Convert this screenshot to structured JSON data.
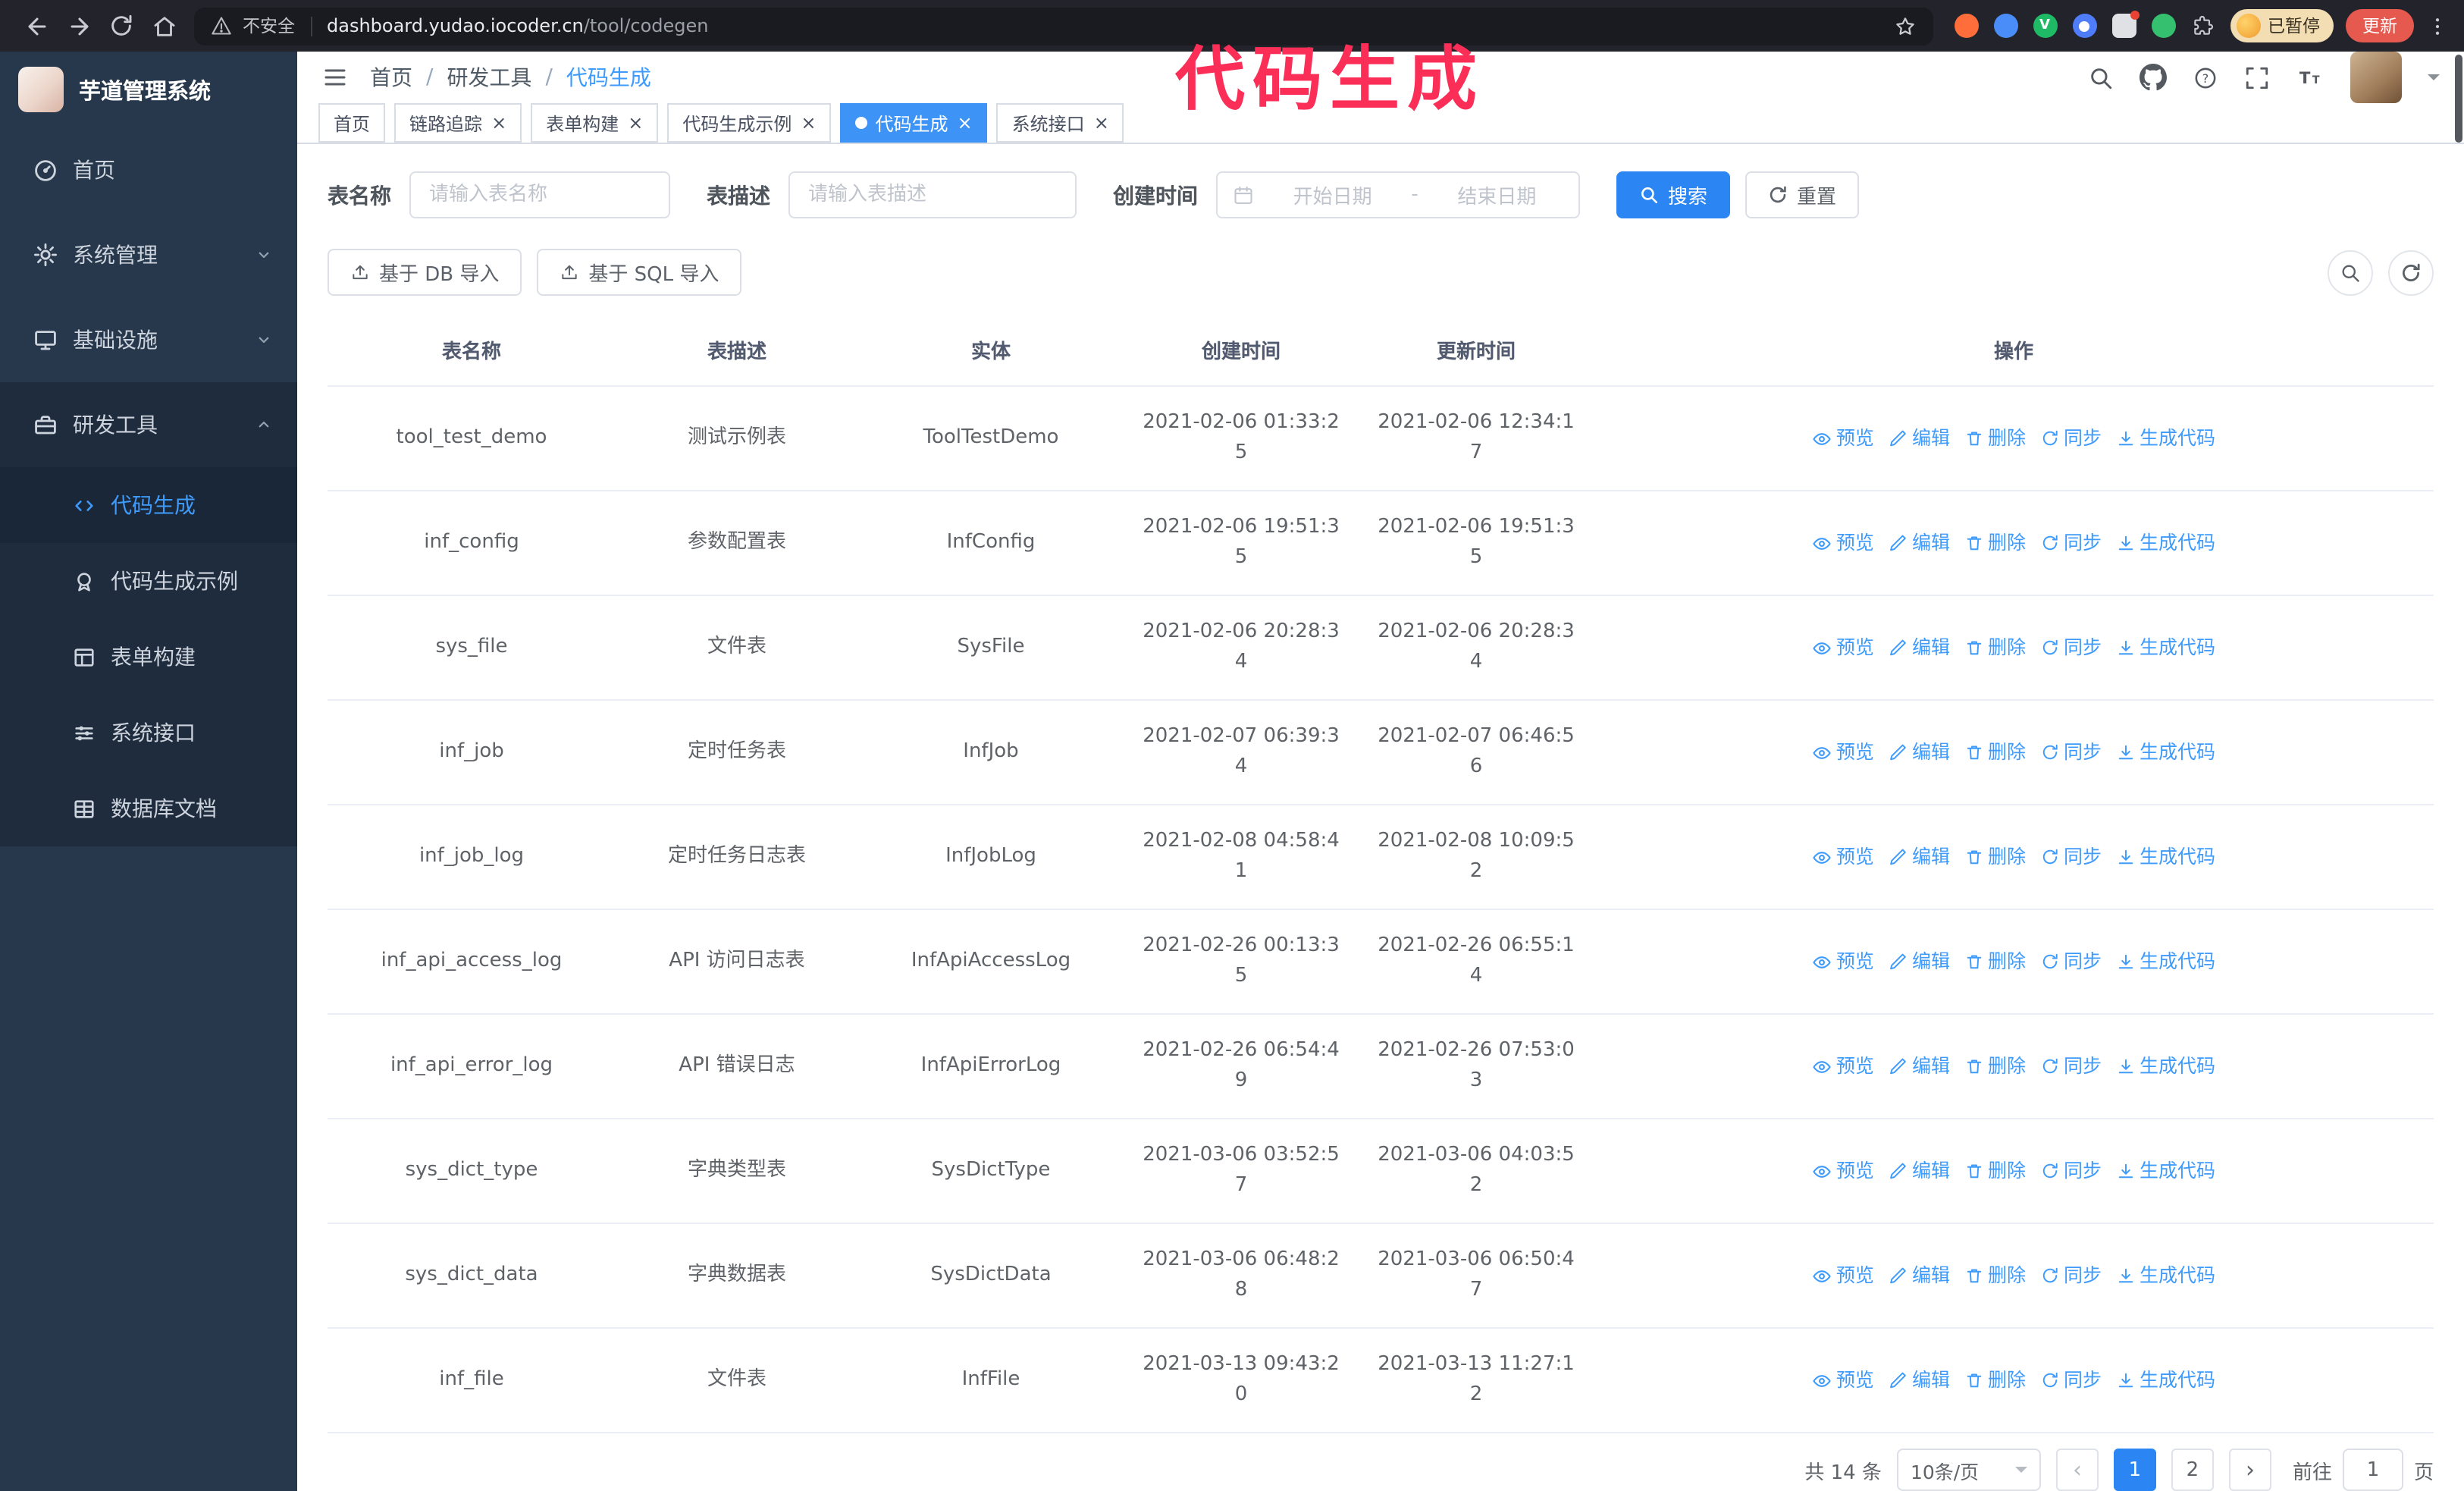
{
  "browser": {
    "security_warning": "不安全",
    "url_domain": "dashboard.yudao.iocoder.cn",
    "url_path": "/tool/codegen",
    "paused_badge": "已暂停",
    "update_button": "更新"
  },
  "annotation": {
    "text": "代码生成",
    "color": "#fb2e57"
  },
  "sidebar": {
    "app_title": "芋道管理系统",
    "items": [
      {
        "label": "首页"
      },
      {
        "label": "系统管理"
      },
      {
        "label": "基础设施"
      },
      {
        "label": "研发工具"
      }
    ],
    "submenu": [
      {
        "label": "代码生成"
      },
      {
        "label": "代码生成示例"
      },
      {
        "label": "表单构建"
      },
      {
        "label": "系统接口"
      },
      {
        "label": "数据库文档"
      }
    ]
  },
  "breadcrumb": {
    "items": [
      "首页",
      "研发工具",
      "代码生成"
    ],
    "separator": "/"
  },
  "tabs": [
    {
      "label": "首页"
    },
    {
      "label": "链路追踪"
    },
    {
      "label": "表单构建"
    },
    {
      "label": "代码生成示例"
    },
    {
      "label": "代码生成"
    },
    {
      "label": "系统接口"
    }
  ],
  "filters": {
    "table_name_label": "表名称",
    "table_name_placeholder": "请输入表名称",
    "table_desc_label": "表描述",
    "table_desc_placeholder": "请输入表描述",
    "create_time_label": "创建时间",
    "date_start_placeholder": "开始日期",
    "date_separator": "-",
    "date_end_placeholder": "结束日期",
    "search_button": "搜索",
    "reset_button": "重置"
  },
  "actions": {
    "import_db": "基于 DB 导入",
    "import_sql": "基于 SQL 导入"
  },
  "table": {
    "columns": [
      "表名称",
      "表描述",
      "实体",
      "创建时间",
      "更新时间",
      "操作"
    ],
    "op_labels": [
      "预览",
      "编辑",
      "删除",
      "同步",
      "生成代码"
    ],
    "rows": [
      {
        "name": "tool_test_demo",
        "desc": "测试示例表",
        "entity": "ToolTestDemo",
        "created": "2021-02-06 01:33:25",
        "updated": "2021-02-06 12:34:17"
      },
      {
        "name": "inf_config",
        "desc": "参数配置表",
        "entity": "InfConfig",
        "created": "2021-02-06 19:51:35",
        "updated": "2021-02-06 19:51:35"
      },
      {
        "name": "sys_file",
        "desc": "文件表",
        "entity": "SysFile",
        "created": "2021-02-06 20:28:34",
        "updated": "2021-02-06 20:28:34"
      },
      {
        "name": "inf_job",
        "desc": "定时任务表",
        "entity": "InfJob",
        "created": "2021-02-07 06:39:34",
        "updated": "2021-02-07 06:46:56"
      },
      {
        "name": "inf_job_log",
        "desc": "定时任务日志表",
        "entity": "InfJobLog",
        "created": "2021-02-08 04:58:41",
        "updated": "2021-02-08 10:09:52"
      },
      {
        "name": "inf_api_access_log",
        "desc": "API 访问日志表",
        "entity": "InfApiAccessLog",
        "created": "2021-02-26 00:13:35",
        "updated": "2021-02-26 06:55:14"
      },
      {
        "name": "inf_api_error_log",
        "desc": "API 错误日志",
        "entity": "InfApiErrorLog",
        "created": "2021-02-26 06:54:49",
        "updated": "2021-02-26 07:53:03"
      },
      {
        "name": "sys_dict_type",
        "desc": "字典类型表",
        "entity": "SysDictType",
        "created": "2021-03-06 03:52:57",
        "updated": "2021-03-06 04:03:52"
      },
      {
        "name": "sys_dict_data",
        "desc": "字典数据表",
        "entity": "SysDictData",
        "created": "2021-03-06 06:48:28",
        "updated": "2021-03-06 06:50:47"
      },
      {
        "name": "inf_file",
        "desc": "文件表",
        "entity": "InfFile",
        "created": "2021-03-13 09:43:20",
        "updated": "2021-03-13 11:27:12"
      }
    ]
  },
  "pagination": {
    "total": "共 14 条",
    "page_size": "10条/页",
    "page_1": "1",
    "page_2": "2",
    "goto_label": "前往",
    "goto_value": "1",
    "goto_unit": "页"
  }
}
